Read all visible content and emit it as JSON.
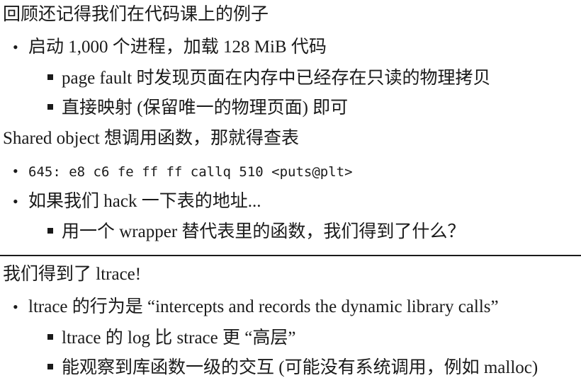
{
  "section1": {
    "heading": "回顾还记得我们在代码课上的例子",
    "item1": {
      "text": "启动 1,000 个进程，加载 128 MiB 代码",
      "sub": [
        "page fault 时发现页面在内存中已经存在只读的物理拷贝",
        "直接映射 (保留唯一的物理页面) 即可"
      ]
    }
  },
  "section2": {
    "heading": "Shared object 想调用函数，那就得查表",
    "code_line": "645: e8 c6 fe ff ff callq 510 <puts@plt>",
    "item2": {
      "text": "如果我们 hack 一下表的地址...",
      "sub": [
        "用一个 wrapper 替代表里的函数，我们得到了什么？"
      ]
    }
  },
  "section3": {
    "heading": "我们得到了 ltrace!",
    "item1": {
      "text": "ltrace 的行为是 “intercepts and records the dynamic library calls”",
      "sub": [
        "ltrace 的 log 比 strace 更 “高层”",
        "能观察到库函数一级的交互 (可能没有系统调用，例如 malloc)"
      ]
    }
  }
}
